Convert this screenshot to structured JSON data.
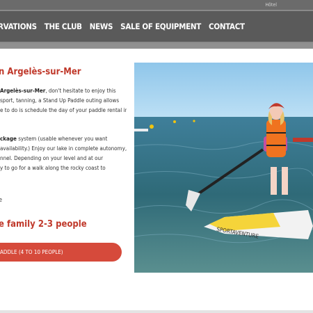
{
  "header": {
    "lang_label": "Hôtel"
  },
  "nav": {
    "items": [
      {
        "label": "RVATIONS"
      },
      {
        "label": "THE CLUB"
      },
      {
        "label": "NEWS"
      },
      {
        "label": "SALE OF EQUIPMENT"
      },
      {
        "label": "CONTACT"
      }
    ]
  },
  "main": {
    "title": "n Argelès-sur-Mer",
    "p1": {
      "line1_bold": "Argelès-sur-Mer",
      "line1_rest": ", don't hesitate to enjoy this",
      "line2": "sport, tanning, a Stand Up Paddle outing allows",
      "line3": "e to do is schedule the day of your paddle rental in"
    },
    "p2": {
      "line1_bold": "ckage",
      "line1_rest": " system (usable whenever you want",
      "line2": "availability.) Enjoy our lake in complete autonomy,",
      "line3": "nnel. Depending on your level and at our",
      "line4": "y to go for a walk along the rocky coast to"
    },
    "stray_char": "e",
    "subtitle": "e family 2-3 people",
    "cta_label": "ADDLE (4 TO 10 PEOPLE)"
  },
  "photo": {
    "board_text": "SPORTAVENTURE"
  },
  "colors": {
    "accent": "#c0392b",
    "button": "#d64a3b",
    "nav_bg": "#5a5a5a"
  }
}
